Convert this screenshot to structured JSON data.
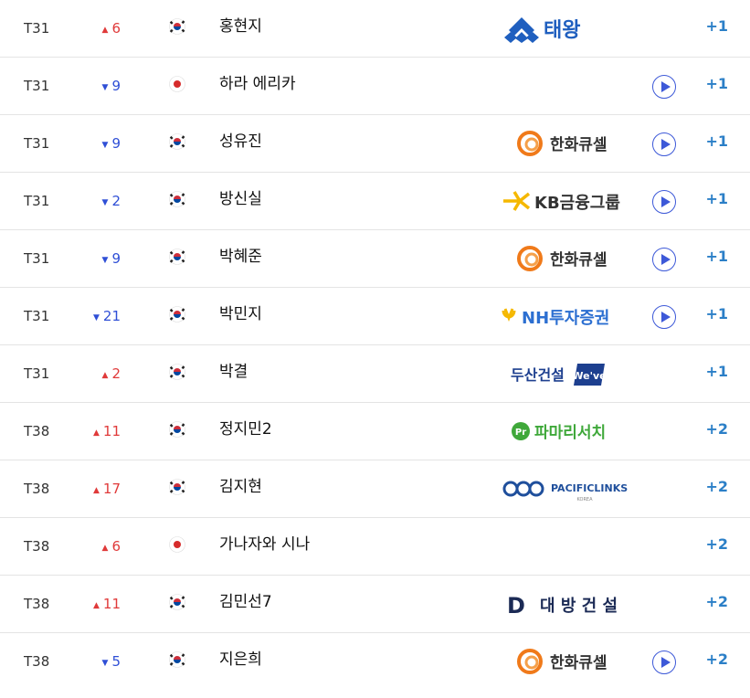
{
  "rows": [
    {
      "pos": "T31",
      "dir": "up",
      "arrow": "▲",
      "move": "6",
      "country": "kr",
      "name": "홍현지",
      "sponsor": "taeyoung",
      "video": false,
      "score": "+1"
    },
    {
      "pos": "T31",
      "dir": "down",
      "arrow": "▼",
      "move": "9",
      "country": "jp",
      "name": "하라 에리카",
      "sponsor": "",
      "video": true,
      "score": "+1"
    },
    {
      "pos": "T31",
      "dir": "down",
      "arrow": "▼",
      "move": "9",
      "country": "kr",
      "name": "성유진",
      "sponsor": "hanwha",
      "video": true,
      "score": "+1"
    },
    {
      "pos": "T31",
      "dir": "down",
      "arrow": "▼",
      "move": "2",
      "country": "kr",
      "name": "방신실",
      "sponsor": "kb",
      "video": true,
      "score": "+1"
    },
    {
      "pos": "T31",
      "dir": "down",
      "arrow": "▼",
      "move": "9",
      "country": "kr",
      "name": "박혜준",
      "sponsor": "hanwha",
      "video": true,
      "score": "+1"
    },
    {
      "pos": "T31",
      "dir": "down",
      "arrow": "▼",
      "move": "21",
      "country": "kr",
      "name": "박민지",
      "sponsor": "nh",
      "video": true,
      "score": "+1"
    },
    {
      "pos": "T31",
      "dir": "up",
      "arrow": "▲",
      "move": "2",
      "country": "kr",
      "name": "박결",
      "sponsor": "doosan",
      "video": false,
      "score": "+1"
    },
    {
      "pos": "T38",
      "dir": "up",
      "arrow": "▲",
      "move": "11",
      "country": "kr",
      "name": "정지민2",
      "sponsor": "pamarisearch",
      "video": false,
      "score": "+2"
    },
    {
      "pos": "T38",
      "dir": "up",
      "arrow": "▲",
      "move": "17",
      "country": "kr",
      "name": "김지현",
      "sponsor": "pacific",
      "video": false,
      "score": "+2"
    },
    {
      "pos": "T38",
      "dir": "up",
      "arrow": "▲",
      "move": "6",
      "country": "jp",
      "name": "가나자와 시나",
      "sponsor": "",
      "video": false,
      "score": "+2"
    },
    {
      "pos": "T38",
      "dir": "up",
      "arrow": "▲",
      "move": "11",
      "country": "kr",
      "name": "김민선7",
      "sponsor": "daebang",
      "video": false,
      "score": "+2"
    },
    {
      "pos": "T38",
      "dir": "down",
      "arrow": "▼",
      "move": "5",
      "country": "kr",
      "name": "지은희",
      "sponsor": "hanwha",
      "video": true,
      "score": "+2"
    }
  ],
  "sponsors": {
    "taeyoung": {
      "text": "태왕",
      "color": "#1f5fbf"
    },
    "hanwha": {
      "text": "한화큐셀",
      "color": "#f07a1a"
    },
    "kb": {
      "text": "KB금융그룹",
      "color": "#f5b800"
    },
    "nh": {
      "text": "NH투자증권",
      "color": "#2c6fd1"
    },
    "doosan": {
      "text": "두산건설",
      "badge": "We've",
      "color": "#1d3f8f"
    },
    "pamarisearch": {
      "text": "파마리서치",
      "color": "#3fa83a"
    },
    "pacific": {
      "text": "PACIFICLINKS",
      "sub": "KOREA",
      "color": "#1f4f9c"
    },
    "daebang": {
      "text": "대 방 건 설",
      "letter": "D",
      "color": "#1b2a55"
    }
  },
  "icons": {
    "video": "play-circle-icon",
    "flag_kr": "korea-flag-icon",
    "flag_jp": "japan-flag-icon"
  }
}
